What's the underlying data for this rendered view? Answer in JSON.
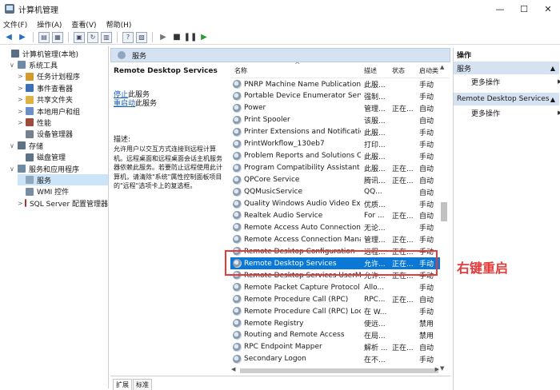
{
  "window": {
    "title": "计算机管理",
    "controls": [
      "—",
      "☐",
      "✕"
    ]
  },
  "menu": [
    "文件(F)",
    "操作(A)",
    "查看(V)",
    "帮助(H)"
  ],
  "tree": {
    "items": [
      {
        "label": "计算机管理(本地)",
        "level": 0,
        "arrow": "",
        "selected": false,
        "color": "#5a6f86"
      },
      {
        "label": "系统工具",
        "level": 1,
        "arrow": "∨",
        "selected": false,
        "color": "#6f8aa5"
      },
      {
        "label": "任务计划程序",
        "level": 2,
        "arrow": ">",
        "selected": false,
        "color": "#d49b2c"
      },
      {
        "label": "事件查看器",
        "level": 2,
        "arrow": ">",
        "selected": false,
        "color": "#3c6fb6"
      },
      {
        "label": "共享文件夹",
        "level": 2,
        "arrow": ">",
        "selected": false,
        "color": "#e0b143"
      },
      {
        "label": "本地用户和组",
        "level": 2,
        "arrow": ">",
        "selected": false,
        "color": "#6d8fc7"
      },
      {
        "label": "性能",
        "level": 2,
        "arrow": ">",
        "selected": false,
        "color": "#9d4c3b"
      },
      {
        "label": "设备管理器",
        "level": 2,
        "arrow": "",
        "selected": false,
        "color": "#768190"
      },
      {
        "label": "存储",
        "level": 1,
        "arrow": "∨",
        "selected": false,
        "color": "#5f7184"
      },
      {
        "label": "磁盘管理",
        "level": 2,
        "arrow": "",
        "selected": false,
        "color": "#5f7184"
      },
      {
        "label": "服务和应用程序",
        "level": 1,
        "arrow": "∨",
        "selected": false,
        "color": "#6f8aa5"
      },
      {
        "label": "服务",
        "level": 2,
        "arrow": "",
        "selected": true,
        "color": "#8fa6bf"
      },
      {
        "label": "WMI 控件",
        "level": 2,
        "arrow": "",
        "selected": false,
        "color": "#7a8ea3"
      },
      {
        "label": "SQL Server 配置管理器",
        "level": 2,
        "arrow": ">",
        "selected": false,
        "color": "#b3332b"
      }
    ]
  },
  "middle": {
    "header": "服务",
    "service_title": "Remote Desktop Services",
    "stop_link": "停止",
    "stop_suffix": "此服务",
    "restart_link": "重启动",
    "restart_suffix": "此服务",
    "desc_label": "描述:",
    "desc_text": "允许用户以交互方式连接到远程计算机。远程桌面和远程桌面会话主机服务器依赖此服务。若要防止远程使用此计算机，请清除\"系统\"属性控制面板项目的\"远程\"选项卡上的复选框。"
  },
  "columns": {
    "name": "名称",
    "desc": "描述",
    "state": "状态",
    "start": "启动类"
  },
  "services": [
    {
      "name": "PNRP Machine Name Publication...",
      "desc": "此服...",
      "state": "",
      "start": "手动"
    },
    {
      "name": "Portable Device Enumerator Serv...",
      "desc": "强制...",
      "state": "",
      "start": "手动"
    },
    {
      "name": "Power",
      "desc": "管理...",
      "state": "正在...",
      "start": "自动"
    },
    {
      "name": "Print Spooler",
      "desc": "该服...",
      "state": "",
      "start": "自动"
    },
    {
      "name": "Printer Extensions and Notificatio...",
      "desc": "此服...",
      "state": "",
      "start": "手动"
    },
    {
      "name": "PrintWorkflow_130eb7",
      "desc": "打印...",
      "state": "",
      "start": "手动"
    },
    {
      "name": "Problem Reports and Solutions C...",
      "desc": "此服...",
      "state": "",
      "start": "手动"
    },
    {
      "name": "Program Compatibility Assistant ...",
      "desc": "此服...",
      "state": "正在...",
      "start": "自动"
    },
    {
      "name": "QPCore Service",
      "desc": "腾讯...",
      "state": "正在...",
      "start": "自动"
    },
    {
      "name": "QQMusicService",
      "desc": "QQ...",
      "state": "",
      "start": "自动"
    },
    {
      "name": "Quality Windows Audio Video Ex...",
      "desc": "优质...",
      "state": "",
      "start": "手动"
    },
    {
      "name": "Realtek Audio Service",
      "desc": "For ...",
      "state": "正在...",
      "start": "自动"
    },
    {
      "name": "Remote Access Auto Connection ...",
      "desc": "无论...",
      "state": "",
      "start": "手动"
    },
    {
      "name": "Remote Access Connection Mana...",
      "desc": "管理...",
      "state": "正在...",
      "start": "手动"
    },
    {
      "name": "Remote Desktop Configuration",
      "desc": "远程...",
      "state": "正在...",
      "start": "手动"
    },
    {
      "name": "Remote Desktop Services",
      "desc": "允许...",
      "state": "正在...",
      "start": "手动"
    },
    {
      "name": "Remote Desktop Services UserM...",
      "desc": "允许...",
      "state": "正在...",
      "start": "手动"
    },
    {
      "name": "Remote Packet Capture Protocol ...",
      "desc": "Allo...",
      "state": "",
      "start": "手动"
    },
    {
      "name": "Remote Procedure Call (RPC)",
      "desc": "RPC...",
      "state": "正在...",
      "start": "自动"
    },
    {
      "name": "Remote Procedure Call (RPC) Loc...",
      "desc": "在 W...",
      "state": "",
      "start": "手动"
    },
    {
      "name": "Remote Registry",
      "desc": "使远...",
      "state": "",
      "start": "禁用"
    },
    {
      "name": "Routing and Remote Access",
      "desc": "在局...",
      "state": "",
      "start": "禁用"
    },
    {
      "name": "RPC Endpoint Mapper",
      "desc": "解析 ...",
      "state": "正在...",
      "start": "自动"
    },
    {
      "name": "Secondary Logon",
      "desc": "在不...",
      "state": "",
      "start": "手动"
    }
  ],
  "selected_service_index": 15,
  "tabs": [
    "扩展",
    "标准"
  ],
  "annotation": {
    "text": "右键重启",
    "color": "#e43a3a"
  },
  "actions": {
    "header": "操作",
    "sections": [
      {
        "title": "服务",
        "item": "更多操作"
      },
      {
        "title": "Remote Desktop Services",
        "item": "更多操作"
      }
    ]
  }
}
